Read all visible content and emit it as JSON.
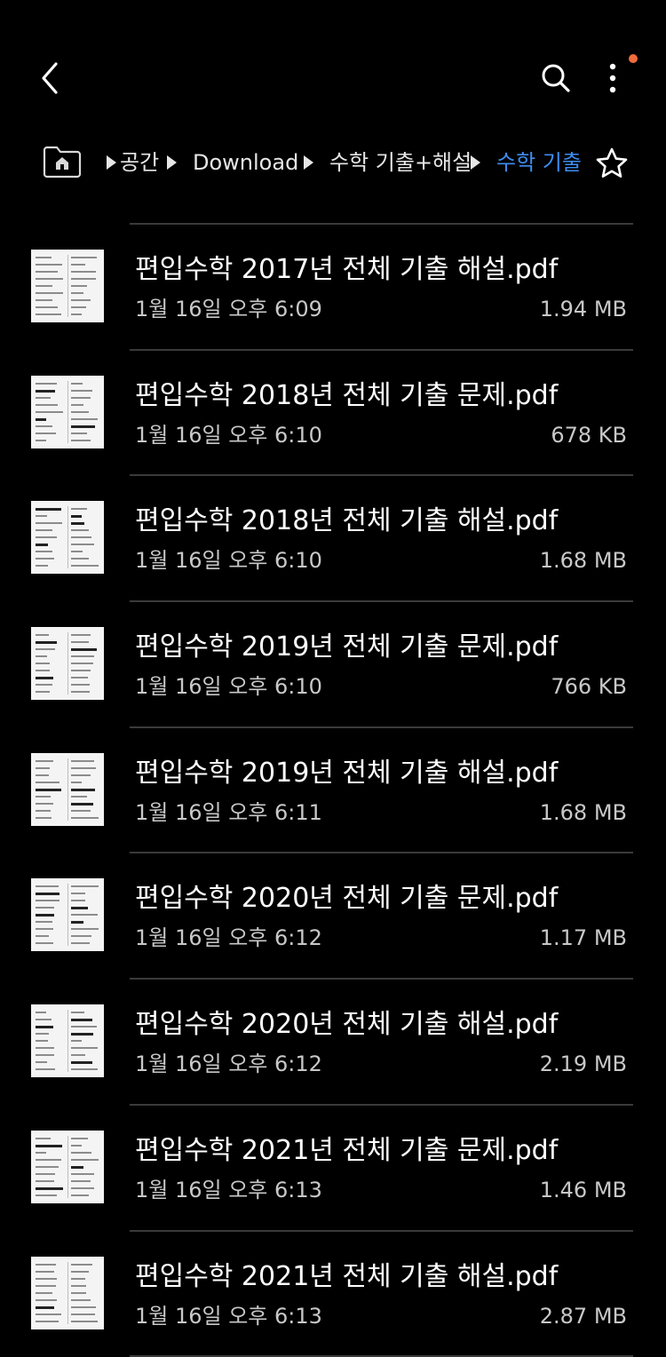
{
  "topbar": {
    "back_icon": "chevron-left-icon",
    "search_icon": "search-icon",
    "more_icon": "more-vertical-icon",
    "notification_dot_color": "#f26b3a"
  },
  "breadcrumb": {
    "home_icon": "home-folder-icon",
    "items": [
      {
        "label": "공간"
      },
      {
        "label": "Download"
      },
      {
        "label": "수학 기출+해설"
      },
      {
        "label": "수학 기출"
      }
    ],
    "active_color": "#3e8df0",
    "star_icon": "star-outline-icon"
  },
  "files": [
    {
      "name": "편입수학 2017년 전체 기출 해설.pdf",
      "date": "1월 16일 오후 6:09",
      "size": "1.94 MB"
    },
    {
      "name": "편입수학 2018년 전체 기출 문제.pdf",
      "date": "1월 16일 오후 6:10",
      "size": "678 KB"
    },
    {
      "name": "편입수학 2018년 전체 기출 해설.pdf",
      "date": "1월 16일 오후 6:10",
      "size": "1.68 MB"
    },
    {
      "name": "편입수학 2019년 전체 기출 문제.pdf",
      "date": "1월 16일 오후 6:10",
      "size": "766 KB"
    },
    {
      "name": "편입수학 2019년 전체 기출 해설.pdf",
      "date": "1월 16일 오후 6:11",
      "size": "1.68 MB"
    },
    {
      "name": "편입수학 2020년 전체 기출 문제.pdf",
      "date": "1월 16일 오후 6:12",
      "size": "1.17 MB"
    },
    {
      "name": "편입수학 2020년 전체 기출 해설.pdf",
      "date": "1월 16일 오후 6:12",
      "size": "2.19 MB"
    },
    {
      "name": "편입수학 2021년 전체 기출 문제.pdf",
      "date": "1월 16일 오후 6:13",
      "size": "1.46 MB"
    },
    {
      "name": "편입수학 2021년 전체 기출 해설.pdf",
      "date": "1월 16일 오후 6:13",
      "size": "2.87 MB"
    }
  ]
}
